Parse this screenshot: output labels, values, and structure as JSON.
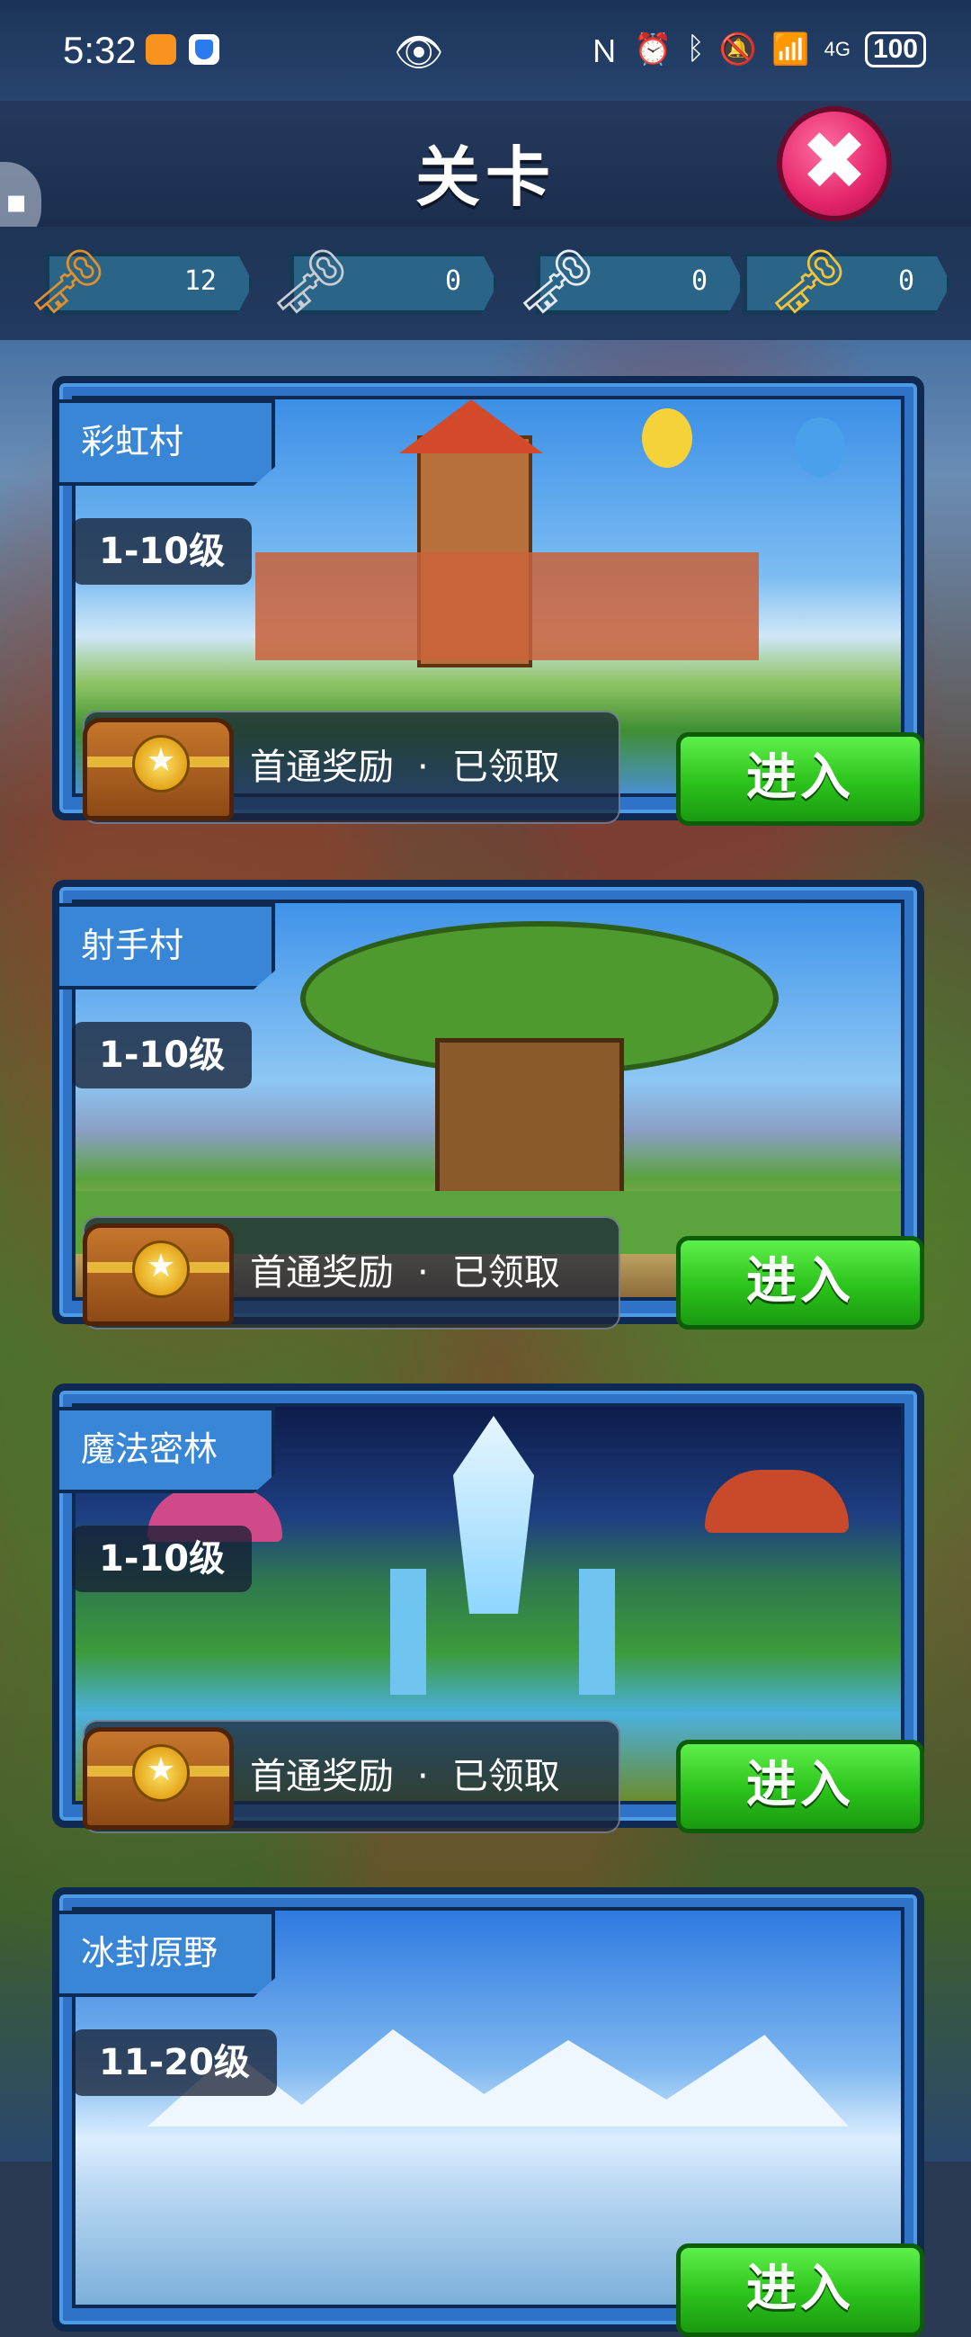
{
  "status_bar": {
    "time": "5:32",
    "eye_icon": "👁",
    "right_icons": [
      "nfc-icon",
      "alarm-icon",
      "bluetooth-icon",
      "mute-icon",
      "wifi-icon"
    ],
    "network": "4G",
    "battery": "100"
  },
  "header": {
    "title": "关卡",
    "close_icon": "✖"
  },
  "keys": [
    {
      "icon": "bronze-key-icon",
      "glyph": "🗝",
      "color": "#e0902c",
      "count": "12"
    },
    {
      "icon": "silver-key-icon",
      "glyph": "🗝",
      "color": "#c8ccd4",
      "count": "0"
    },
    {
      "icon": "platinum-key-icon",
      "glyph": "🗝",
      "color": "#e6eaf2",
      "count": "0"
    },
    {
      "icon": "gold-key-icon",
      "glyph": "🗝",
      "color": "#f3c43a",
      "count": "0"
    }
  ],
  "levels": [
    {
      "name": "彩虹村",
      "range": "1-10级",
      "enter": "进入",
      "reward_label": "首通奖励",
      "reward_dot": "·",
      "reward_status": "已领取"
    },
    {
      "name": "射手村",
      "range": "1-10级",
      "enter": "进入",
      "reward_label": "首通奖励",
      "reward_dot": "·",
      "reward_status": "已领取"
    },
    {
      "name": "魔法密林",
      "range": "1-10级",
      "enter": "进入",
      "reward_label": "首通奖励",
      "reward_dot": "·",
      "reward_status": "已领取"
    },
    {
      "name": "冰封原野",
      "range": "11-20级",
      "enter": "进入"
    }
  ],
  "colors": {
    "enter_green": "#2bc21b",
    "card_blue": "#2f73c9",
    "close_pink": "#e4246b"
  }
}
